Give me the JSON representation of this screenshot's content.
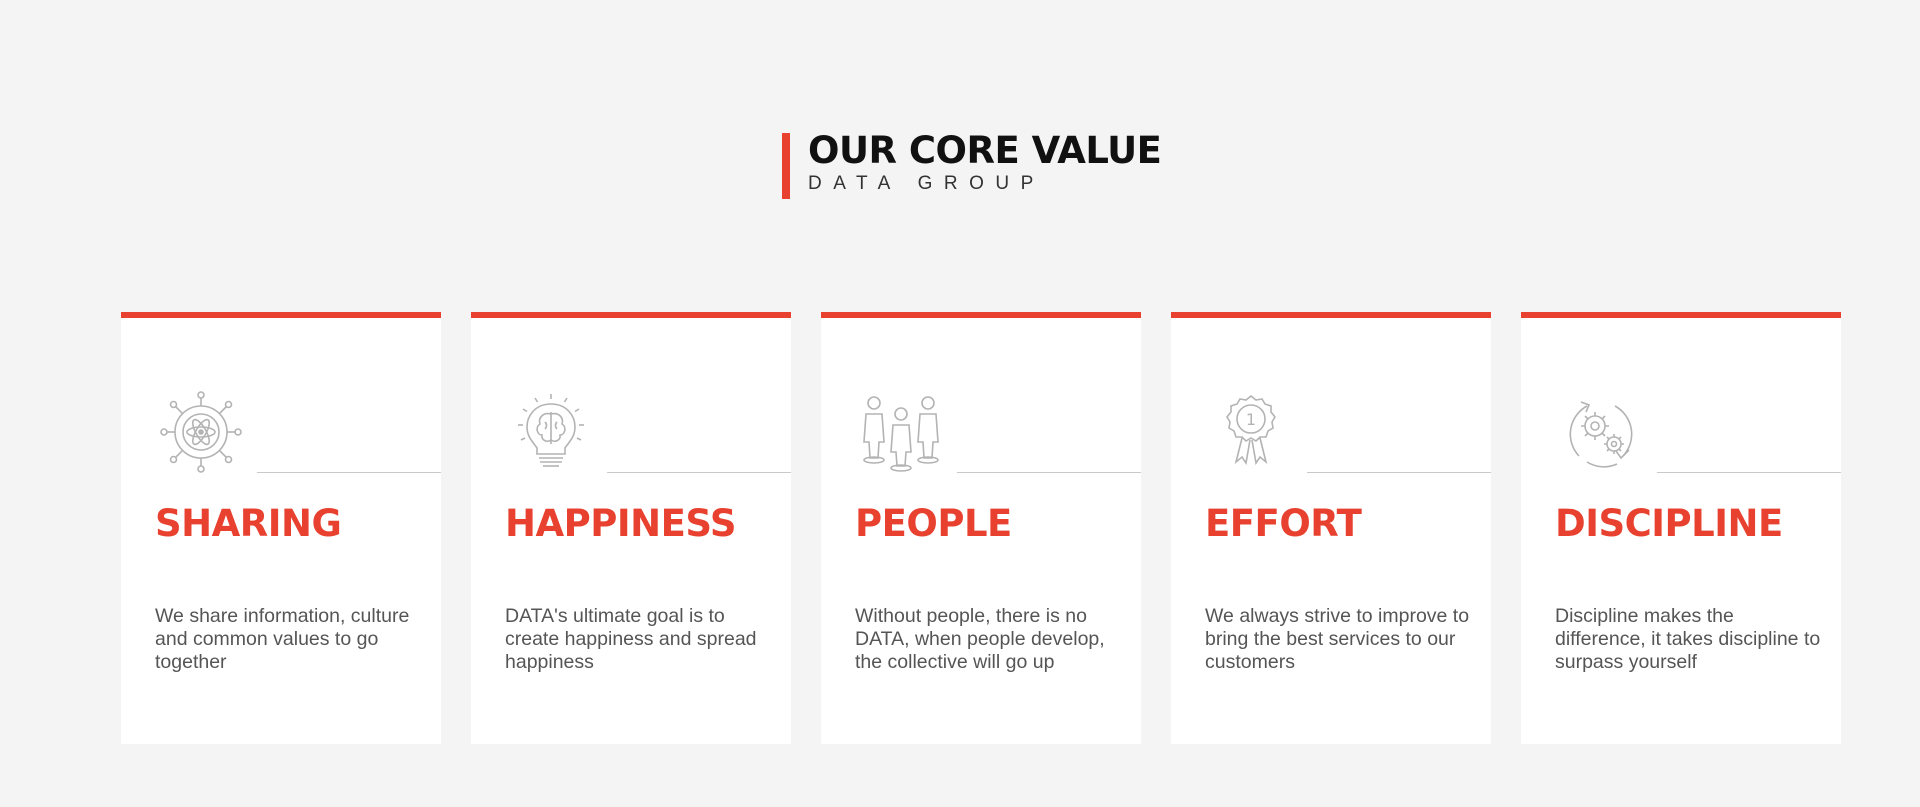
{
  "header": {
    "title": "OUR CORE VALUE",
    "subtitle": "DATA GROUP"
  },
  "colors": {
    "accent": "#e8412f",
    "background": "#f4f4f4",
    "card": "#ffffff",
    "icon": "#b3b3b3"
  },
  "cards": [
    {
      "icon": "atom-network-icon",
      "title": "SHARING",
      "text": "We share information, culture and common values to go together"
    },
    {
      "icon": "lightbulb-brain-icon",
      "title": "HAPPINESS",
      "text": "DATA's ultimate goal is to create happiness and spread happiness"
    },
    {
      "icon": "people-group-icon",
      "title": "PEOPLE",
      "text": "Without people, there is no DATA, when people develop, the collective will go up"
    },
    {
      "icon": "award-medal-icon",
      "title": "EFFORT",
      "text": "We always strive to improve to bring the best services to our customers"
    },
    {
      "icon": "gears-cycle-icon",
      "title": "DISCIPLINE",
      "text": "Discipline makes the difference, it takes discipline to surpass yourself"
    }
  ]
}
